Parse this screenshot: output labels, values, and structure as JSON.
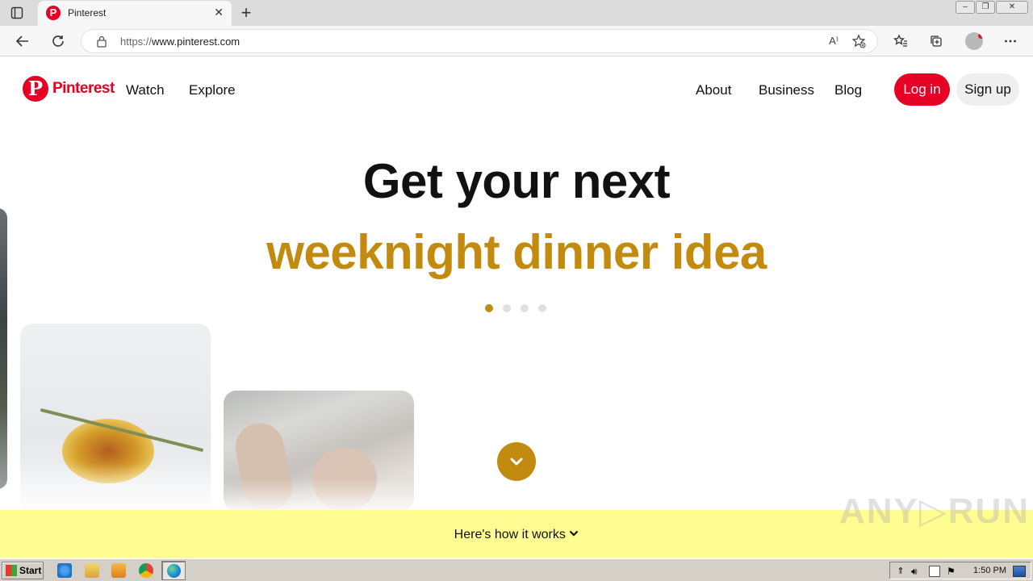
{
  "browser": {
    "tab_title": "Pinterest",
    "tab_favicon_letter": "P",
    "new_tab_symbol": "+",
    "close_tab_symbol": "✕",
    "url_protocol": "https://",
    "url_host": "www.pinterest.com",
    "read_aloud_icon": "A⁾",
    "window_controls": [
      "minimize",
      "restore",
      "close"
    ]
  },
  "header": {
    "logo_mark": "P",
    "logo_text": "Pinterest",
    "nav_left": [
      "Watch",
      "Explore"
    ],
    "nav_right": [
      "About",
      "Business",
      "Blog"
    ],
    "login_label": "Log in",
    "signup_label": "Sign up"
  },
  "hero": {
    "headline_line1": "Get your next",
    "headline_line2": "weeknight dinner idea",
    "carousel_dots": 4,
    "active_dot": 1,
    "accent_color": "#c28b10"
  },
  "banner": {
    "label": "Here's how it works",
    "chevron": "⌄",
    "color": "#fffd92"
  },
  "watermark": "ANY▷RUN",
  "taskbar": {
    "start_label": "Start",
    "clock": "1:50 PM"
  },
  "colors": {
    "brand_red": "#e60023",
    "signup_bg": "#efefef"
  }
}
